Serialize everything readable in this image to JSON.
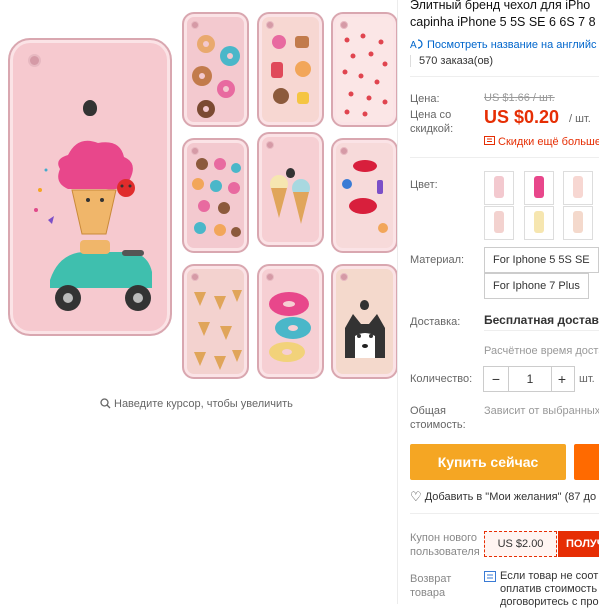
{
  "product": {
    "title_line1": "Элитный бренд чехол для iPho",
    "title_line2": "capinha iPhone 5 5S SE 6 6S 7 8",
    "translate_link": "Посмотреть название на английс",
    "orders": "570 заказа(ов)"
  },
  "gallery": {
    "zoom_hint": "Наведите курсор, чтобы увеличить",
    "thumbnails": [
      "donuts",
      "donuts-pastel",
      "hearts",
      "donuts-grid",
      "ice-cream",
      "lips",
      "ice-cream-faces",
      "donut-drip",
      "husky"
    ]
  },
  "price": {
    "label": "Цена:",
    "original": "US $1.66 / шт.",
    "discount_label": "Цена со скидкой:",
    "sale": "US $0.20",
    "unit": "/ шт.",
    "more_discounts": "Скидки ещё больше"
  },
  "options": {
    "color_label": "Цвет:",
    "swatch_count": 10,
    "material_label": "Материал:",
    "materials": [
      "For Iphone 5 5S SE",
      "For Iphone 7 Plus"
    ]
  },
  "shipping": {
    "label": "Доставка:",
    "value": "Бесплатная доставка",
    "eta": "Расчётное время доста"
  },
  "quantity": {
    "label": "Количество:",
    "minus": "−",
    "value": "1",
    "plus": "+",
    "unit": "шт."
  },
  "total": {
    "label": "Общая стоимость:",
    "value": "Зависит от выбранных"
  },
  "actions": {
    "buy_now": "Купить сейчас",
    "wishlist": "Добавить в \"Мои желания\" (87 до"
  },
  "coupon": {
    "label": "Купон нового пользователя",
    "amount": "US $2.00",
    "get": "ПОЛУЧ"
  },
  "returns": {
    "label": "Возврат товара",
    "line1": "Если товар не соотв",
    "line2": "оплатив стоимость",
    "line3": "договоритесь с про"
  },
  "colors": {
    "price_red": "#e62e04",
    "buy_orange": "#f5a623",
    "case_pink": "#f6c9cf",
    "link_blue": "#0066cc"
  }
}
